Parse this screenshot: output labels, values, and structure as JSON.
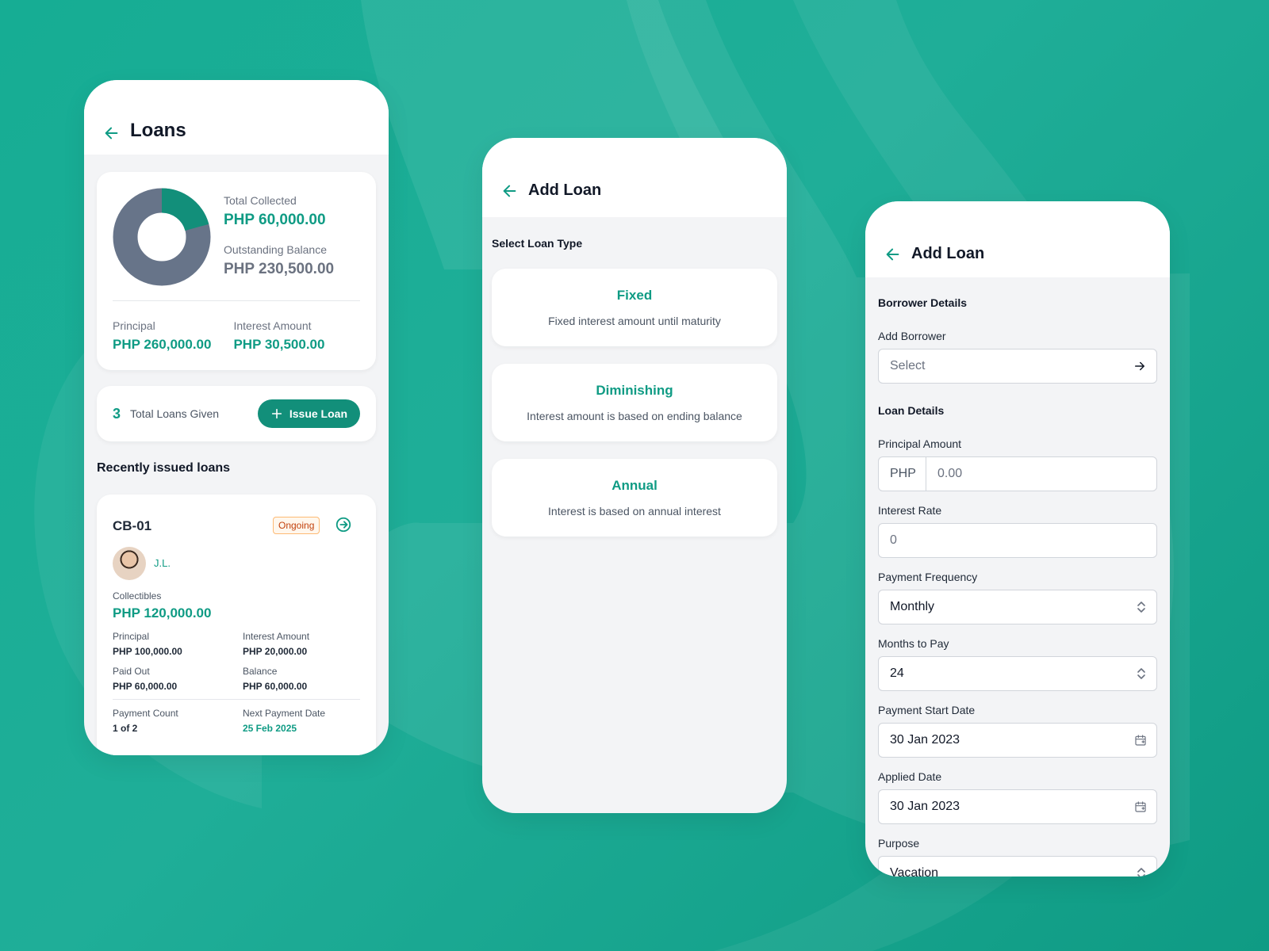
{
  "loans_screen": {
    "title": "Loans",
    "total_collected_label": "Total Collected",
    "total_collected_value": "PHP 60,000.00",
    "outstanding_label": "Outstanding Balance",
    "outstanding_value": "PHP 230,500.00",
    "principal_label": "Principal",
    "principal_value": "PHP 260,000.00",
    "interest_label": "Interest Amount",
    "interest_value": "PHP 30,500.00",
    "donut": {
      "collected_fraction": 0.207,
      "collected_color": "#128f7a",
      "outstanding_color": "#677489"
    },
    "loans_count": "3",
    "loans_given_label": "Total Loans Given",
    "issue_button": "Issue Loan",
    "recent_title": "Recently issued loans",
    "loan": {
      "id": "CB-01",
      "status": "Ongoing",
      "borrower": "J.L.",
      "collectibles_label": "Collectibles",
      "collectibles_value": "PHP 120,000.00",
      "principal_label": "Principal",
      "principal_value": "PHP 100,000.00",
      "interest_label": "Interest Amount",
      "interest_value": "PHP 20,000.00",
      "paid_label": "Paid Out",
      "paid_value": "PHP 60,000.00",
      "balance_label": "Balance",
      "balance_value": "PHP 60,000.00",
      "count_label": "Payment Count",
      "count_value": "1 of 2",
      "next_label": "Next Payment Date",
      "next_value": "25 Feb 2025"
    }
  },
  "loan_type_screen": {
    "title": "Add Loan",
    "select_title": "Select Loan Type",
    "types": [
      {
        "name": "Fixed",
        "desc": "Fixed interest amount until maturity"
      },
      {
        "name": "Diminishing",
        "desc": "Interest amount is based on ending balance"
      },
      {
        "name": "Annual",
        "desc": "Interest is based on annual interest"
      }
    ]
  },
  "add_loan_form": {
    "title": "Add Loan",
    "borrower_section": "Borrower Details",
    "add_borrower_label": "Add Borrower",
    "add_borrower_value": "Select",
    "loan_section": "Loan Details",
    "principal_label": "Principal Amount",
    "currency": "PHP",
    "principal_placeholder": "0.00",
    "interest_label": "Interest Rate",
    "interest_placeholder": "0",
    "frequency_label": "Payment Frequency",
    "frequency_value": "Monthly",
    "months_label": "Months to Pay",
    "months_value": "24",
    "start_label": "Payment Start Date",
    "start_value": "30 Jan 2023",
    "applied_label": "Applied Date",
    "applied_value": "30 Jan 2023",
    "purpose_label": "Purpose",
    "purpose_value": "Vacation"
  },
  "colors": {
    "accent": "#0f9b84",
    "background": "#16ad94",
    "badge": "#c2410c"
  }
}
